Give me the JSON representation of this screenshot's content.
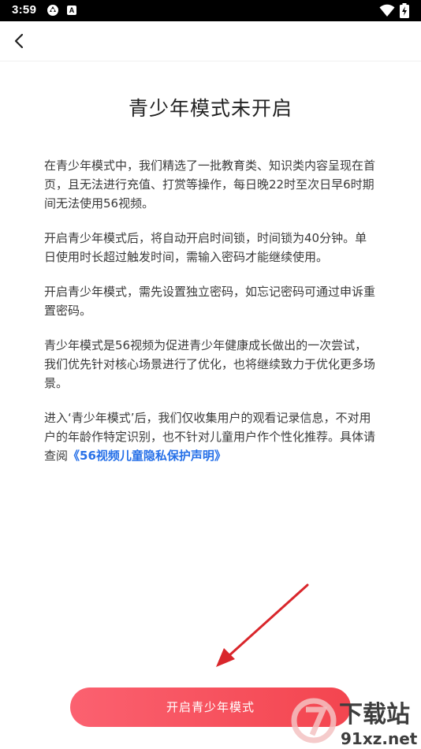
{
  "status_bar": {
    "time": "3:59",
    "a_label": "A"
  },
  "nav": {
    "back_icon": "chevron-left-icon"
  },
  "title": "青少年模式未开启",
  "content": {
    "paragraphs": [
      "在青少年模式中，我们精选了一批教育类、知识类内容呈现在首页，且无法进行充值、打赏等操作，每日晚22时至次日早6时期间无法使用56视频。",
      "开启青少年模式后，将自动开启时间锁，时间锁为40分钟。单日使用时长超过触发时间，需输入密码才能继续使用。",
      "开启青少年模式，需先设置独立密码，如忘记密码可通过申诉重置密码。",
      "青少年模式是56视频为促进青少年健康成长做出的一次尝试，我们优先针对核心场景进行了优化，也将继续致力于优化更多场景。"
    ],
    "last_paragraph_text": "进入‘青少年模式’后，我们仅收集用户的观看记录信息，不对用户的年龄作特定识别，也不针对儿童用户作个性化推荐。具体请查阅",
    "policy_link": "《56视频儿童隐私保护声明》"
  },
  "button": {
    "label": "开启青少年模式"
  },
  "watermark": {
    "brand": "下载站",
    "domain": "91xz.net"
  },
  "colors": {
    "button_start": "#fb6170",
    "button_end": "#f3454f",
    "link": "#2670e8",
    "arrow": "#d9262b"
  }
}
